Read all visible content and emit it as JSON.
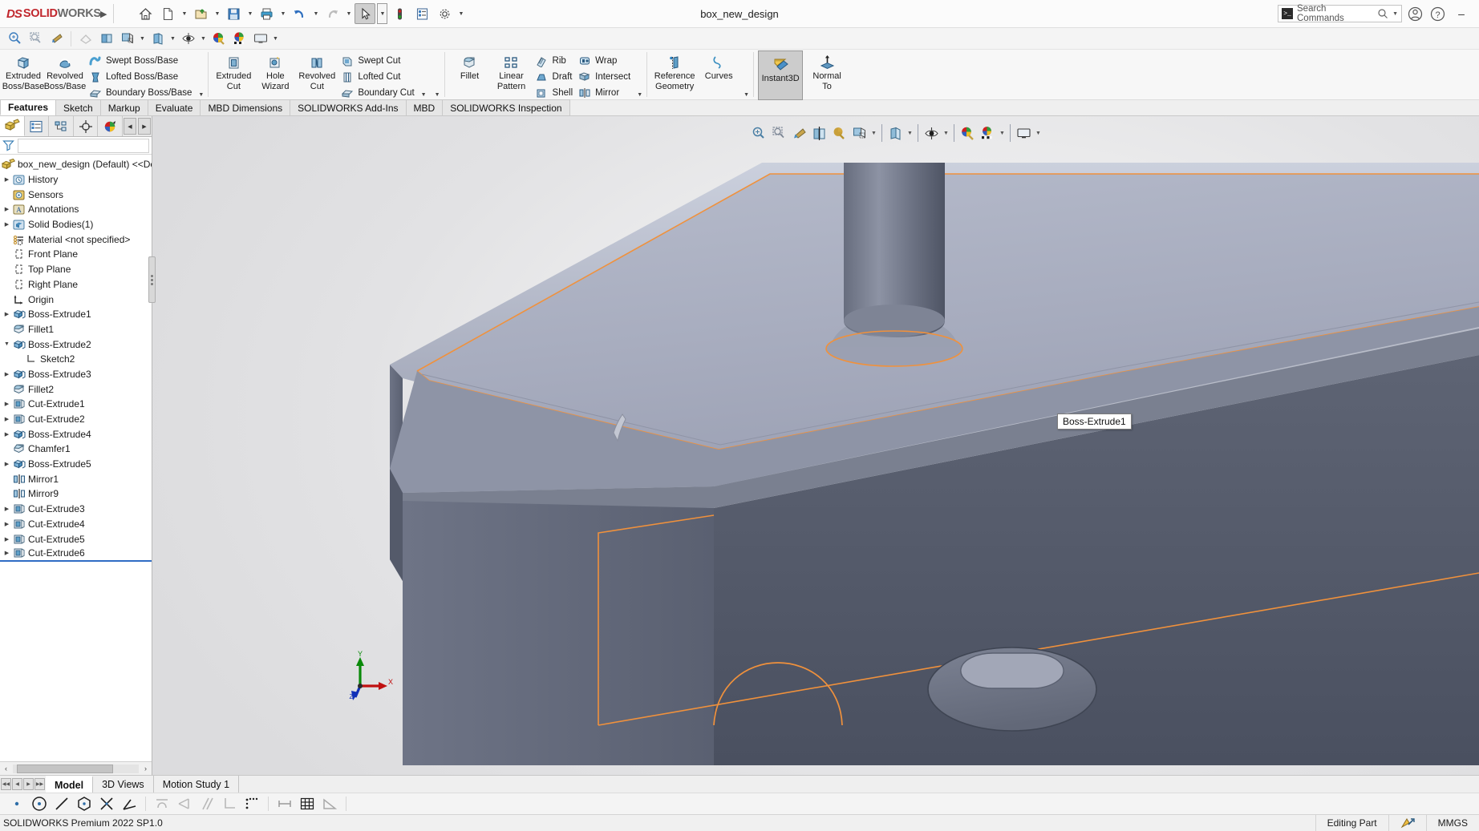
{
  "app": {
    "brand_ds": "DS",
    "brand_solid": "SOLID",
    "brand_works": "WORKS",
    "document_title": "box_new_design",
    "version_text": "SOLIDWORKS Premium 2022 SP1.0"
  },
  "titlebar": {
    "search_placeholder": "Search Commands",
    "expand_label": "▶",
    "minimize_label": "–",
    "buttons": [
      {
        "name": "home-icon",
        "label": "Home"
      },
      {
        "name": "new-document-icon",
        "label": "New"
      },
      {
        "name": "open-document-icon",
        "label": "Open"
      },
      {
        "name": "save-icon",
        "label": "Save"
      },
      {
        "name": "print-icon",
        "label": "Print"
      },
      {
        "name": "undo-icon",
        "label": "Undo"
      },
      {
        "name": "redo-icon",
        "label": "Redo"
      },
      {
        "name": "select-cursor-icon",
        "label": "Select"
      },
      {
        "name": "rebuild-icon",
        "label": "Rebuild"
      },
      {
        "name": "file-properties-icon",
        "label": "File Properties"
      },
      {
        "name": "options-gear-icon",
        "label": "Options"
      }
    ]
  },
  "viewbar": {
    "buttons": [
      {
        "name": "zoom-to-fit-icon",
        "label": "Zoom to Fit"
      },
      {
        "name": "zoom-to-area-icon",
        "label": "Zoom to Area"
      },
      {
        "name": "previous-view-icon",
        "label": "Previous View"
      },
      {
        "name": "section-view-icon",
        "label": "Section View"
      },
      {
        "name": "view-orientation-icon",
        "label": "View Orientation"
      },
      {
        "name": "display-style-icon",
        "label": "Display Style"
      },
      {
        "name": "hide-show-items-icon",
        "label": "Hide/Show Items"
      },
      {
        "name": "edit-appearance-icon",
        "label": "Edit Appearance"
      },
      {
        "name": "apply-scene-icon",
        "label": "Apply Scene"
      },
      {
        "name": "view-settings-icon",
        "label": "View Settings"
      }
    ]
  },
  "ribbon": {
    "groups": [
      {
        "name": "boss-base-group",
        "big": [
          {
            "name": "extruded-boss-base-button",
            "line1": "Extruded",
            "line2": "Boss/Base",
            "icon": "extruded-boss-icon"
          },
          {
            "name": "revolved-boss-base-button",
            "line1": "Revolved",
            "line2": "Boss/Base",
            "icon": "revolved-boss-icon"
          }
        ],
        "small": [
          {
            "name": "swept-boss-base-button",
            "label": "Swept Boss/Base",
            "icon": "swept-boss-icon"
          },
          {
            "name": "lofted-boss-base-button",
            "label": "Lofted Boss/Base",
            "icon": "lofted-boss-icon"
          },
          {
            "name": "boundary-boss-base-button",
            "label": "Boundary Boss/Base",
            "icon": "boundary-boss-icon"
          }
        ],
        "has_caret": true
      },
      {
        "name": "cut-group",
        "big": [
          {
            "name": "extruded-cut-button",
            "line1": "Extruded",
            "line2": "Cut",
            "icon": "extruded-cut-icon"
          },
          {
            "name": "hole-wizard-button",
            "line1": "Hole",
            "line2": "Wizard",
            "icon": "hole-wizard-icon"
          },
          {
            "name": "revolved-cut-button",
            "line1": "Revolved",
            "line2": "Cut",
            "icon": "revolved-cut-icon"
          }
        ],
        "small": [
          {
            "name": "swept-cut-button",
            "label": "Swept Cut",
            "icon": "swept-cut-icon"
          },
          {
            "name": "lofted-cut-button",
            "label": "Lofted Cut",
            "icon": "lofted-cut-icon"
          },
          {
            "name": "boundary-cut-button",
            "label": "Boundary Cut",
            "icon": "boundary-cut-icon"
          }
        ],
        "has_caret": true
      },
      {
        "name": "features-group",
        "big": [
          {
            "name": "fillet-button",
            "line1": "Fillet",
            "line2": "",
            "icon": "fillet-icon"
          },
          {
            "name": "linear-pattern-button",
            "line1": "Linear",
            "line2": "Pattern",
            "icon": "linear-pattern-icon"
          }
        ],
        "small": [
          {
            "name": "rib-button",
            "label": "Rib",
            "icon": "rib-icon"
          },
          {
            "name": "draft-button",
            "label": "Draft",
            "icon": "draft-icon"
          },
          {
            "name": "shell-button",
            "label": "Shell",
            "icon": "shell-icon"
          }
        ],
        "small2": [
          {
            "name": "wrap-button",
            "label": "Wrap",
            "icon": "wrap-icon"
          },
          {
            "name": "intersect-button",
            "label": "Intersect",
            "icon": "intersect-icon"
          },
          {
            "name": "mirror-button",
            "label": "Mirror",
            "icon": "mirror-icon"
          }
        ],
        "has_caret": true
      },
      {
        "name": "reference-group",
        "big": [
          {
            "name": "reference-geometry-button",
            "line1": "Reference",
            "line2": "Geometry",
            "icon": "reference-geometry-icon"
          },
          {
            "name": "curves-button",
            "line1": "Curves",
            "line2": "",
            "icon": "curves-icon"
          }
        ],
        "small": [],
        "has_caret": true
      },
      {
        "name": "instant3d-group",
        "boxed": {
          "name": "instant3d-button",
          "line1": "Instant3D",
          "line2": "",
          "icon": "instant3d-icon",
          "active": true
        },
        "big": [
          {
            "name": "normal-to-button",
            "line1": "Normal",
            "line2": "To",
            "icon": "normal-to-icon"
          }
        ],
        "small": []
      }
    ]
  },
  "command_tabs": [
    {
      "name": "tab-features",
      "label": "Features",
      "active": true
    },
    {
      "name": "tab-sketch",
      "label": "Sketch",
      "active": false
    },
    {
      "name": "tab-markup",
      "label": "Markup",
      "active": false
    },
    {
      "name": "tab-evaluate",
      "label": "Evaluate",
      "active": false
    },
    {
      "name": "tab-mbd-dimensions",
      "label": "MBD Dimensions",
      "active": false
    },
    {
      "name": "tab-solidworks-add-ins",
      "label": "SOLIDWORKS Add-Ins",
      "active": false
    },
    {
      "name": "tab-mbd",
      "label": "MBD",
      "active": false
    },
    {
      "name": "tab-solidworks-inspection",
      "label": "SOLIDWORKS Inspection",
      "active": false
    }
  ],
  "feature_manager": {
    "tabs": [
      {
        "name": "feature-manager-tree-tab",
        "icon": "feature-tree-icon",
        "active": true
      },
      {
        "name": "property-manager-tab",
        "icon": "property-manager-icon",
        "active": false
      },
      {
        "name": "configuration-manager-tab",
        "icon": "configuration-manager-icon",
        "active": false
      },
      {
        "name": "dimxpert-manager-tab",
        "icon": "dimxpert-icon",
        "active": false
      },
      {
        "name": "display-manager-tab",
        "icon": "display-manager-icon",
        "active": false
      }
    ],
    "nav_prev": "◀",
    "nav_next": "▶",
    "filter_placeholder": "",
    "root_label": "box_new_design (Default) <<Default>",
    "items": [
      {
        "name": "tree-item-history",
        "label": "History",
        "icon": "history-icon",
        "indent": 1,
        "expandable": true,
        "expanded": false
      },
      {
        "name": "tree-item-sensors",
        "label": "Sensors",
        "icon": "sensors-icon",
        "indent": 1,
        "expandable": false,
        "expanded": false
      },
      {
        "name": "tree-item-annotations",
        "label": "Annotations",
        "icon": "annotations-icon",
        "indent": 1,
        "expandable": true,
        "expanded": false
      },
      {
        "name": "tree-item-solid-bodies",
        "label": "Solid Bodies(1)",
        "icon": "solid-bodies-icon",
        "indent": 1,
        "expandable": true,
        "expanded": false
      },
      {
        "name": "tree-item-material",
        "label": "Material <not specified>",
        "icon": "material-icon",
        "indent": 1,
        "expandable": false,
        "expanded": false
      },
      {
        "name": "tree-item-front-plane",
        "label": "Front Plane",
        "icon": "plane-icon",
        "indent": 1,
        "expandable": false,
        "expanded": false
      },
      {
        "name": "tree-item-top-plane",
        "label": "Top Plane",
        "icon": "plane-icon",
        "indent": 1,
        "expandable": false,
        "expanded": false
      },
      {
        "name": "tree-item-right-plane",
        "label": "Right Plane",
        "icon": "plane-icon",
        "indent": 1,
        "expandable": false,
        "expanded": false
      },
      {
        "name": "tree-item-origin",
        "label": "Origin",
        "icon": "origin-icon",
        "indent": 1,
        "expandable": false,
        "expanded": false
      },
      {
        "name": "tree-item-boss-extrude1",
        "label": "Boss-Extrude1",
        "icon": "boss-extrude-icon",
        "indent": 1,
        "expandable": true,
        "expanded": false
      },
      {
        "name": "tree-item-fillet1",
        "label": "Fillet1",
        "icon": "fillet-feature-icon",
        "indent": 1,
        "expandable": false,
        "expanded": false
      },
      {
        "name": "tree-item-boss-extrude2",
        "label": "Boss-Extrude2",
        "icon": "boss-extrude-icon",
        "indent": 1,
        "expandable": true,
        "expanded": true
      },
      {
        "name": "tree-item-sketch2",
        "label": "Sketch2",
        "icon": "sketch-icon",
        "indent": 2,
        "expandable": false,
        "expanded": false
      },
      {
        "name": "tree-item-boss-extrude3",
        "label": "Boss-Extrude3",
        "icon": "boss-extrude-icon",
        "indent": 1,
        "expandable": true,
        "expanded": false
      },
      {
        "name": "tree-item-fillet2",
        "label": "Fillet2",
        "icon": "fillet-feature-icon",
        "indent": 1,
        "expandable": false,
        "expanded": false
      },
      {
        "name": "tree-item-cut-extrude1",
        "label": "Cut-Extrude1",
        "icon": "cut-extrude-icon",
        "indent": 1,
        "expandable": true,
        "expanded": false
      },
      {
        "name": "tree-item-cut-extrude2",
        "label": "Cut-Extrude2",
        "icon": "cut-extrude-icon",
        "indent": 1,
        "expandable": true,
        "expanded": false
      },
      {
        "name": "tree-item-boss-extrude4",
        "label": "Boss-Extrude4",
        "icon": "boss-extrude-icon",
        "indent": 1,
        "expandable": true,
        "expanded": false
      },
      {
        "name": "tree-item-chamfer1",
        "label": "Chamfer1",
        "icon": "chamfer-icon",
        "indent": 1,
        "expandable": false,
        "expanded": false
      },
      {
        "name": "tree-item-boss-extrude5",
        "label": "Boss-Extrude5",
        "icon": "boss-extrude-icon",
        "indent": 1,
        "expandable": true,
        "expanded": false
      },
      {
        "name": "tree-item-mirror1",
        "label": "Mirror1",
        "icon": "mirror-feature-icon",
        "indent": 1,
        "expandable": false,
        "expanded": false
      },
      {
        "name": "tree-item-mirror9",
        "label": "Mirror9",
        "icon": "mirror-feature-icon",
        "indent": 1,
        "expandable": false,
        "expanded": false
      },
      {
        "name": "tree-item-cut-extrude3",
        "label": "Cut-Extrude3",
        "icon": "cut-extrude-icon",
        "indent": 1,
        "expandable": true,
        "expanded": false
      },
      {
        "name": "tree-item-cut-extrude4",
        "label": "Cut-Extrude4",
        "icon": "cut-extrude-icon",
        "indent": 1,
        "expandable": true,
        "expanded": false
      },
      {
        "name": "tree-item-cut-extrude5",
        "label": "Cut-Extrude5",
        "icon": "cut-extrude-icon",
        "indent": 1,
        "expandable": true,
        "expanded": false
      },
      {
        "name": "tree-item-cut-extrude6",
        "label": "Cut-Extrude6",
        "icon": "cut-extrude-icon",
        "indent": 1,
        "expandable": true,
        "expanded": false
      }
    ],
    "hscroll_left": "‹",
    "hscroll_right": "›"
  },
  "viewport": {
    "tooltip_text": "Boss-Extrude1",
    "triad_x": "X",
    "triad_y": "Y",
    "triad_z": "Z",
    "hud_buttons": [
      {
        "name": "zoom-to-fit-hud-icon",
        "label": "Zoom to Fit"
      },
      {
        "name": "zoom-to-area-hud-icon",
        "label": "Zoom to Area"
      },
      {
        "name": "previous-view-hud-icon",
        "label": "Previous View"
      },
      {
        "name": "section-view-hud-icon",
        "label": "Section View"
      },
      {
        "name": "view-orientation-hud-icon",
        "label": "View Orientation"
      },
      {
        "name": "display-style-hud-icon",
        "label": "Display Style"
      },
      {
        "name": "hide-show-hud-icon",
        "label": "Hide/Show Items"
      },
      {
        "name": "edit-appearance-hud-icon",
        "label": "Edit Appearance"
      },
      {
        "name": "apply-scene-hud-icon",
        "label": "Apply Scene"
      },
      {
        "name": "view-settings-hud-icon",
        "label": "View Settings"
      }
    ],
    "colors": {
      "model_top_face": "#a9aec0",
      "model_side_face": "#5b6273",
      "model_dark_face": "#474d5c",
      "selection_edge": "#f0913c",
      "background": "#ececed"
    }
  },
  "bottom_tabs": {
    "nav": [
      "❙◀",
      "◀",
      "▶",
      "▶❙"
    ],
    "tabs": [
      {
        "name": "bottom-tab-model",
        "label": "Model",
        "active": true
      },
      {
        "name": "bottom-tab-3d-views",
        "label": "3D Views",
        "active": false
      },
      {
        "name": "bottom-tab-motion-study",
        "label": "Motion Study 1",
        "active": false
      }
    ]
  },
  "sketch_toolbar": {
    "buttons": [
      {
        "name": "point-tool-icon",
        "label": "Point"
      },
      {
        "name": "circle-tool-icon",
        "label": "Circle"
      },
      {
        "name": "line-tool-icon",
        "label": "Line"
      },
      {
        "name": "polygon-tool-icon",
        "label": "Polygon"
      },
      {
        "name": "trim-entities-icon",
        "label": "Trim Entities"
      },
      {
        "name": "sketch-fillet-icon",
        "label": "Sketch Fillet"
      },
      {
        "name": "tangent-relation-icon",
        "label": "Tangent"
      },
      {
        "name": "coincident-relation-icon",
        "label": "Coincident"
      },
      {
        "name": "parallel-relation-icon",
        "label": "Parallel"
      },
      {
        "name": "perpendicular-relation-icon",
        "label": "Perpendicular"
      },
      {
        "name": "collinear-relation-icon",
        "label": "Collinear"
      },
      {
        "name": "smart-dimension-icon",
        "label": "Smart Dimension"
      },
      {
        "name": "grid-icon",
        "label": "Grid"
      },
      {
        "name": "angle-dimension-icon",
        "label": "Angle"
      }
    ]
  },
  "statusbar": {
    "left": "SOLIDWORKS Premium 2022 SP1.0",
    "editing_state": "Editing Part",
    "unit_system": "MMGS",
    "tolerance_icon": "tolerance-status-icon"
  }
}
